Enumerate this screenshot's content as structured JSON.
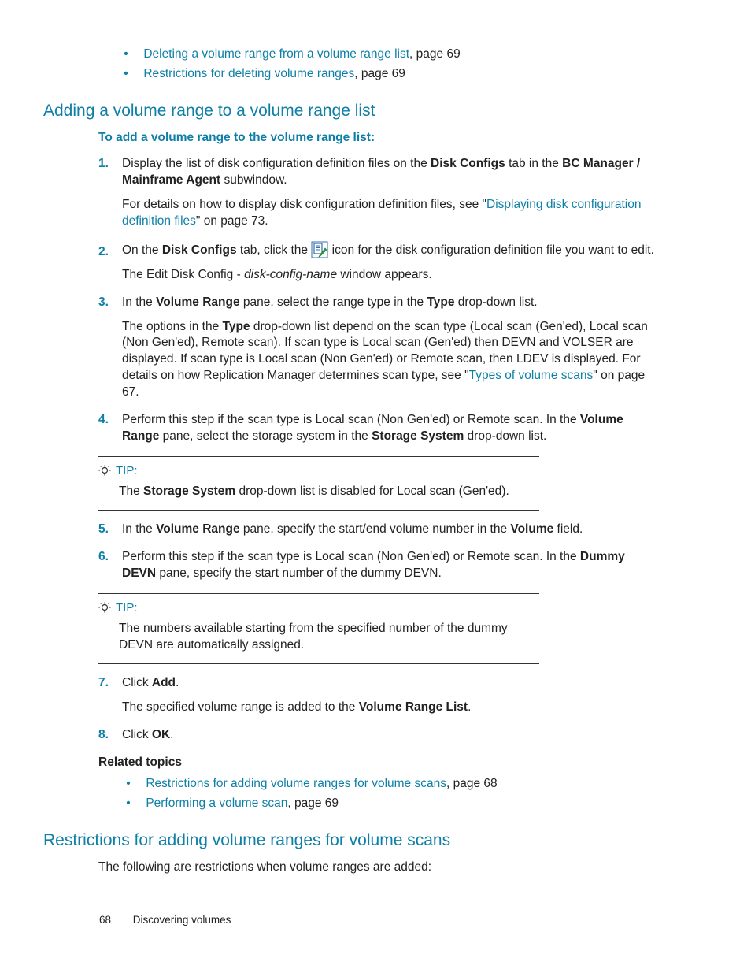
{
  "top_links": [
    {
      "text": "Deleting a volume range from a volume range list",
      "suffix": ", page 69"
    },
    {
      "text": "Restrictions for deleting volume ranges",
      "suffix": ", page 69"
    }
  ],
  "section1_title": "Adding a volume range to a volume range list",
  "proc_title": "To add a volume range to the volume range list:",
  "s1_a": "Display the list of disk configuration definition files on the ",
  "s1_b": "Disk Configs",
  "s1_c": " tab in the ",
  "s1_d": "BC Manager / Mainframe Agent",
  "s1_e": " subwindow.",
  "s1_f": "For details on how to display disk configuration definition files, see \"",
  "s1_g": "Displaying disk configuration definition files",
  "s1_h": "\" on page 73.",
  "s2_a": "On the ",
  "s2_b": "Disk Configs",
  "s2_c": " tab, click the ",
  "s2_d": " icon for the disk configuration definition file you want to edit.",
  "s2_e": "The Edit Disk Config - ",
  "s2_f": "disk-config-name",
  "s2_g": " window appears.",
  "s3_a": "In the ",
  "s3_b": "Volume Range",
  "s3_c": " pane, select the range type in the ",
  "s3_d": "Type",
  "s3_e": " drop-down list.",
  "s3_f": "The options in the ",
  "s3_g": "Type",
  "s3_h": " drop-down list depend on the scan type (Local scan (Gen'ed), Local scan (Non Gen'ed), Remote scan). If scan type is Local scan (Gen'ed) then DEVN and VOLSER are displayed. If scan type is Local scan (Non Gen'ed) or Remote scan, then LDEV is displayed. For details on how Replication Manager determines scan type, see \"",
  "s3_i": "Types of volume scans",
  "s3_j": "\" on page 67.",
  "s4_a": "Perform this step if the scan type is Local scan (Non Gen'ed) or Remote scan. In the ",
  "s4_b": "Volume Range",
  "s4_c": " pane, select the storage system in the ",
  "s4_d": "Storage System",
  "s4_e": " drop-down list.",
  "tip1_label": "TIP:",
  "tip1_a": "The ",
  "tip1_b": "Storage System",
  "tip1_c": " drop-down list is disabled for Local scan (Gen'ed).",
  "s5_a": "In the ",
  "s5_b": "Volume Range",
  "s5_c": " pane, specify the start/end volume number in the ",
  "s5_d": "Volume",
  "s5_e": " field.",
  "s6_a": "Perform this step if the scan type is Local scan (Non Gen'ed) or Remote scan. In the ",
  "s6_b": "Dummy DEVN",
  "s6_c": " pane, specify the start number of the dummy DEVN.",
  "tip2_label": "TIP:",
  "tip2_a": "The numbers available starting from the specified number of the dummy DEVN are automatically assigned.",
  "s7_a": "Click ",
  "s7_b": "Add",
  "s7_c": ".",
  "s7_d": "The specified volume range is added to the ",
  "s7_e": "Volume Range List",
  "s7_f": ".",
  "s8_a": "Click ",
  "s8_b": "OK",
  "s8_c": ".",
  "related_title": "Related topics",
  "related": [
    {
      "text": "Restrictions for adding volume ranges for volume scans",
      "suffix": ", page 68"
    },
    {
      "text": "Performing a volume scan",
      "suffix": ", page 69"
    }
  ],
  "section2_title": "Restrictions for adding volume ranges for volume scans",
  "section2_intro": "The following are restrictions when volume ranges are added:",
  "footer_page": "68",
  "footer_text": "Discovering volumes"
}
